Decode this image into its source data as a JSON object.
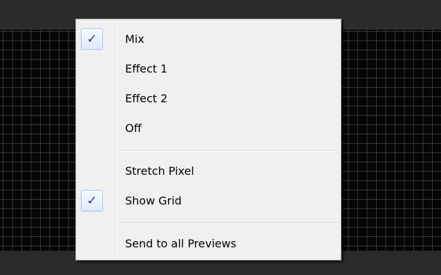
{
  "menu": {
    "items": [
      {
        "label": "Mix",
        "checked": true,
        "check_glyph": "✓"
      },
      {
        "label": "Effect 1",
        "checked": false
      },
      {
        "label": "Effect 2",
        "checked": false
      },
      {
        "label": "Off",
        "checked": false
      },
      {
        "label": "Stretch Pixel",
        "checked": false
      },
      {
        "label": "Show Grid",
        "checked": true,
        "check_glyph": "✓"
      },
      {
        "label": "Send to all Previews",
        "checked": false
      }
    ]
  },
  "colors": {
    "menu_background": "#f0f0f0",
    "check_color": "#1c3d8c",
    "preview_background": "#050505",
    "grid_line": "#3a3a3a",
    "window_background": "#2b2b2b"
  }
}
